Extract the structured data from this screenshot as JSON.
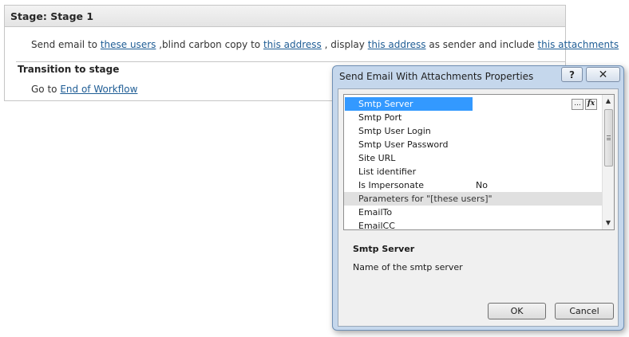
{
  "stage": {
    "title": "Stage: Stage 1",
    "sentence": {
      "t1": "Send email to ",
      "link1": "these users",
      "t2": " ,blind carbon copy to ",
      "link2": "this address",
      "t3": " , display ",
      "link3": "this address",
      "t4": " as sender and include ",
      "link4": "this attachments"
    },
    "transition_title": "Transition to stage",
    "goto_text": "Go to ",
    "goto_link": "End of Workflow"
  },
  "dialog": {
    "title": "Send Email With Attachments Properties",
    "help_glyph": "?",
    "close_glyph": "✕",
    "grid": {
      "rows": [
        {
          "name": "Smtp Server",
          "value": ""
        },
        {
          "name": "Smtp Port",
          "value": ""
        },
        {
          "name": "Smtp User Login",
          "value": ""
        },
        {
          "name": "Smtp User Password",
          "value": ""
        },
        {
          "name": "Site URL",
          "value": ""
        },
        {
          "name": "List identifier",
          "value": ""
        },
        {
          "name": "Is Impersonate",
          "value": "No"
        },
        {
          "name": "Parameters for \"[these users]\"",
          "value": ""
        },
        {
          "name": "EmailTo",
          "value": ""
        },
        {
          "name": "EmailCC",
          "value": ""
        }
      ],
      "builder_button": "...",
      "fx_button": "fx",
      "scroll_up": "▲",
      "scroll_down": "▼"
    },
    "description": {
      "title": "Smtp Server",
      "text": "Name of the smtp server"
    },
    "ok_label": "OK",
    "cancel_label": "Cancel"
  }
}
